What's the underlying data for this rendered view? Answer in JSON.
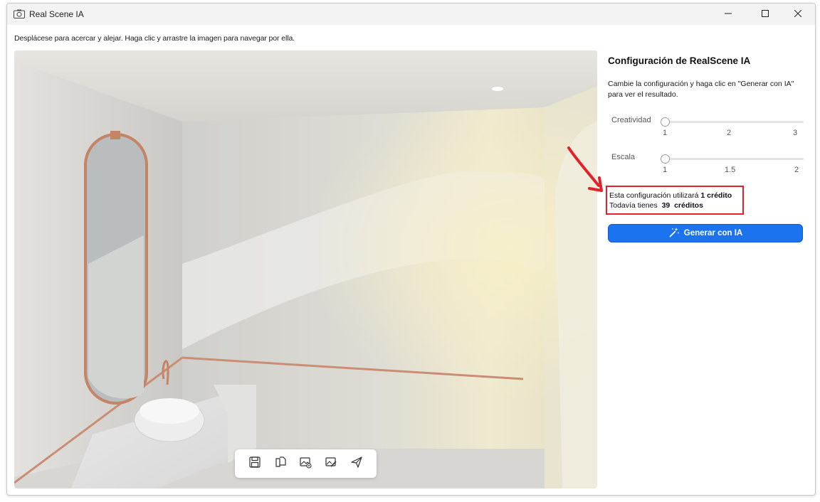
{
  "window": {
    "title": "Real Scene IA",
    "icons": {
      "app": "camera-icon",
      "minimize": "minimize-icon",
      "maximize": "maximize-icon",
      "close": "close-icon"
    }
  },
  "instruction": "Desplácese para acercar y alejar. Haga clic y arrastre la imagen para navegar por ella.",
  "toolbar": {
    "buttons": [
      {
        "name": "save-button",
        "icon": "save-icon"
      },
      {
        "name": "copy-button",
        "icon": "copy-icon"
      },
      {
        "name": "image-settings-button",
        "icon": "image-settings-icon"
      },
      {
        "name": "image-edit-button",
        "icon": "image-edit-icon"
      },
      {
        "name": "send-button",
        "icon": "send-icon"
      }
    ]
  },
  "panel": {
    "title": "Configuración de RealScene IA",
    "description": "Cambie la configuración y haga clic en \"Generar con IA\" para ver el resultado.",
    "creatividad": {
      "label": "Creatividad",
      "ticks": [
        "1",
        "2",
        "3"
      ],
      "value": 1,
      "min": 1,
      "max": 3
    },
    "escala": {
      "label": "Escala",
      "ticks": [
        "1",
        "1.5",
        "2"
      ],
      "value": 1,
      "min": 1,
      "max": 2
    },
    "credits": {
      "line1_prefix": "Esta configuración utilizará",
      "line1_bold": "1 crédito",
      "line2_prefix": "Todavía tienes",
      "line2_count": "39",
      "line2_suffix": "créditos"
    },
    "generate_button": {
      "label": "Generar con IA",
      "icon": "magic-wand-icon"
    }
  },
  "colors": {
    "accent": "#1b73f0",
    "highlight": "#e0232b"
  }
}
